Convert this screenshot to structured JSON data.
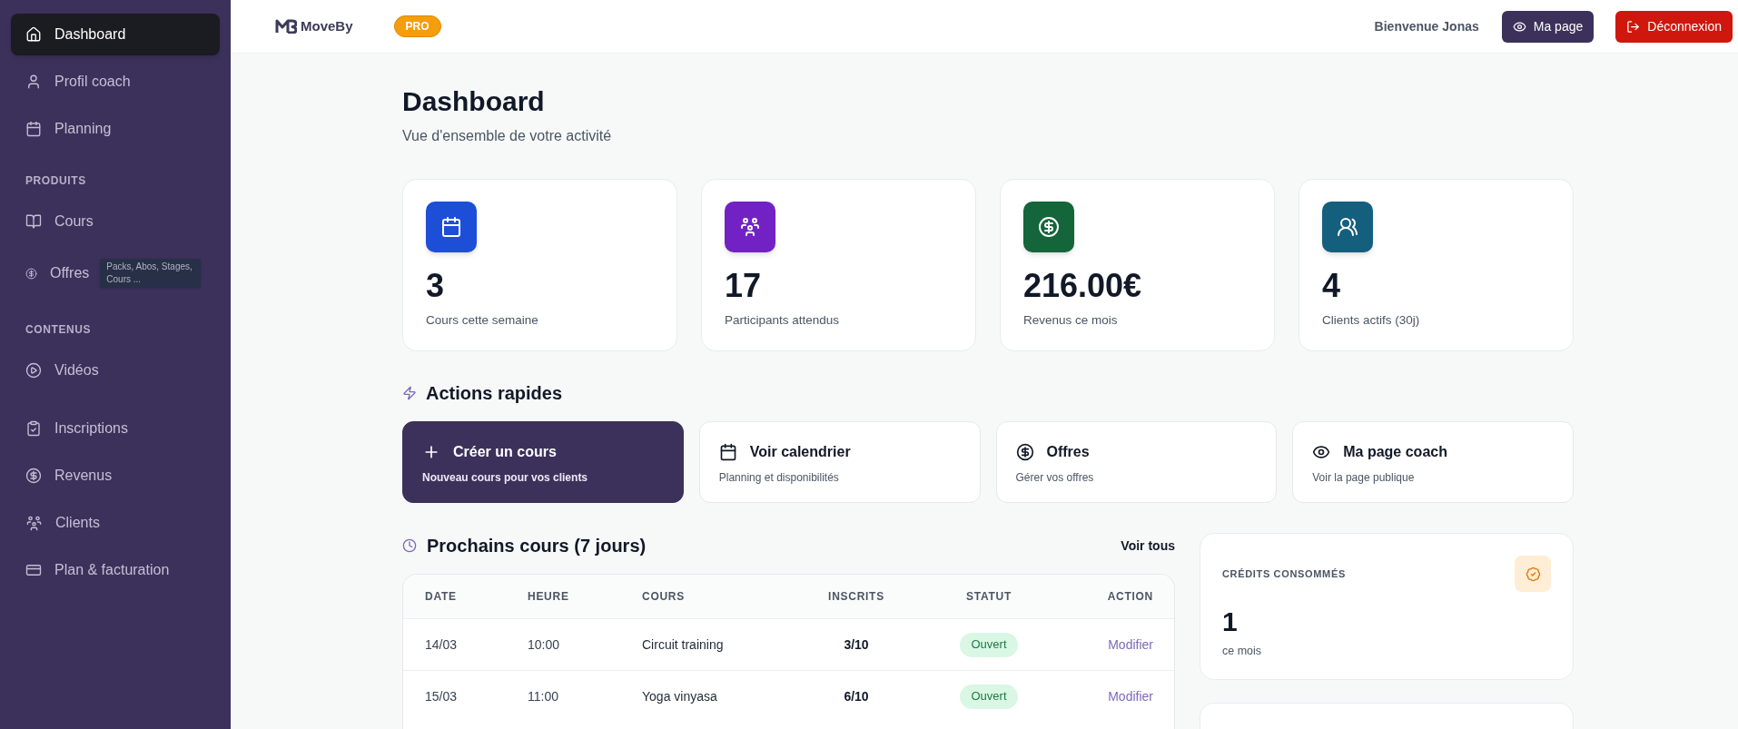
{
  "sidebar": {
    "sections": [
      {
        "items": [
          {
            "label": "Dashboard",
            "selected": true
          },
          {
            "label": "Profil coach",
            "selected": false
          },
          {
            "label": "Planning",
            "selected": false
          }
        ]
      },
      {
        "heading": "PRODUITS",
        "items": [
          {
            "label": "Cours",
            "selected": false
          },
          {
            "label": "Offres",
            "selected": false,
            "note": "Packs, Abos, Stages, Cours ..."
          }
        ]
      },
      {
        "heading": "CONTENUS",
        "items": [
          {
            "label": "Vidéos",
            "selected": false
          }
        ]
      },
      {
        "items": [
          {
            "label": "Inscriptions",
            "selected": false
          },
          {
            "label": "Revenus",
            "selected": false
          },
          {
            "label": "Clients",
            "selected": false
          },
          {
            "label": "Plan & facturation",
            "selected": false
          }
        ]
      }
    ]
  },
  "header": {
    "brand": "MoveBy",
    "plan_badge": "PRO",
    "greeting": "Bienvenue **Jonas**",
    "buttons": [
      {
        "label": "Ma page",
        "kind": "secondary"
      },
      {
        "label": "Déconnexion",
        "kind": "danger"
      }
    ]
  },
  "page": {
    "title": "Dashboard",
    "subtitle": "Vue d'ensemble de votre activité"
  },
  "stats": [
    {
      "value": "3",
      "label": "Cours cette semaine",
      "color": "#1d4ed8"
    },
    {
      "value": "17",
      "label": "Participants attendus",
      "color": "#7222c4"
    },
    {
      "value": "216.00€",
      "label": "Revenus ce mois",
      "color": "#14653a"
    },
    {
      "value": "4",
      "label": "Clients actifs (30j)",
      "color": "#155f7e"
    }
  ],
  "quick_actions": {
    "title": "Actions rapides",
    "items": [
      {
        "title": "Créer un cours",
        "description": "Nouveau cours pour vos clients",
        "kind": "primary"
      },
      {
        "title": "Voir calendrier",
        "description": "Planning et disponibilités",
        "kind": "default"
      },
      {
        "title": "Offres",
        "description": "Gérer vos offres",
        "kind": "default"
      },
      {
        "title": "Ma page coach",
        "description": "Voir la page publique",
        "kind": "default"
      }
    ]
  },
  "upcoming": {
    "title": "Prochains cours (7 jours)",
    "link": "Voir tous",
    "table": {
      "columns": [
        "DATE",
        "HEURE",
        "COURS",
        "INSCRITS",
        "STATUT",
        "ACTION"
      ],
      "rows": [
        [
          "14/03",
          "10:00",
          "Circuit training",
          "3/10",
          "Ouvert",
          "Modifier"
        ],
        [
          "15/03",
          "11:00",
          "Yoga vinyasa",
          "6/10",
          "Ouvert",
          "Modifier"
        ]
      ]
    }
  },
  "side_cards": [
    {
      "title": "CRÉDITS CONSOMMÉS",
      "value": "1",
      "caption": "ce mois"
    }
  ]
}
